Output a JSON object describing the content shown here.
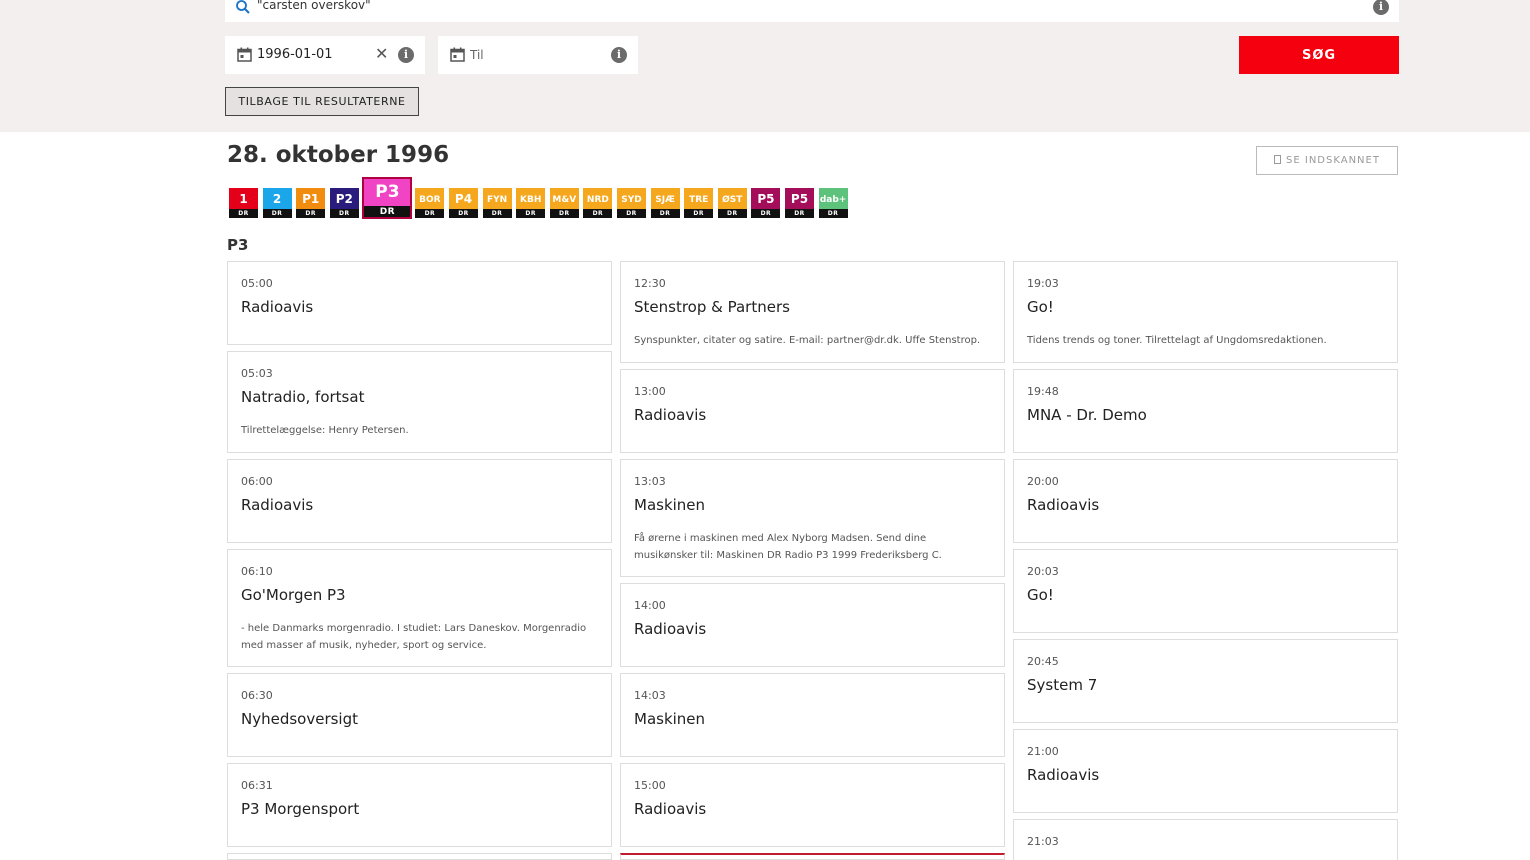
{
  "search": {
    "query": "\"carsten overskov\""
  },
  "filters": {
    "from_value": "1996-01-01",
    "to_placeholder": "Til",
    "search_button": "SØG"
  },
  "back_button": "TILBAGE TIL RESULTATERNE",
  "date_title": "28. oktober 1996",
  "scan_button": "SE INDSKANNET",
  "channels": [
    {
      "top": "1",
      "bottom": "DR",
      "color": "#e4001b"
    },
    {
      "top": "2",
      "bottom": "DR",
      "color": "#1aa6e8"
    },
    {
      "top": "P1",
      "bottom": "DR",
      "color": "#f28c0f"
    },
    {
      "top": "P2",
      "bottom": "DR",
      "color": "#2a1c7c"
    },
    {
      "top": "P3",
      "bottom": "DR",
      "color": "#f044c4"
    },
    {
      "top": "BOR",
      "bottom": "DR",
      "color": "#f5a81e"
    },
    {
      "top": "P4",
      "bottom": "DR",
      "color": "#f5a81e"
    },
    {
      "top": "FYN",
      "bottom": "DR",
      "color": "#f5a81e"
    },
    {
      "top": "KBH",
      "bottom": "DR",
      "color": "#f5a81e"
    },
    {
      "top": "M&V",
      "bottom": "DR",
      "color": "#f5a81e"
    },
    {
      "top": "NRD",
      "bottom": "DR",
      "color": "#f5a81e"
    },
    {
      "top": "SYD",
      "bottom": "DR",
      "color": "#f5a81e"
    },
    {
      "top": "SJÆ",
      "bottom": "DR",
      "color": "#f5a81e"
    },
    {
      "top": "TRE",
      "bottom": "DR",
      "color": "#f5a81e"
    },
    {
      "top": "ØST",
      "bottom": "DR",
      "color": "#f5a81e"
    },
    {
      "top": "P5",
      "bottom": "DR",
      "color": "#a30d5a"
    },
    {
      "top": "P5",
      "bottom": "DR",
      "color": "#a30d5a"
    },
    {
      "top": "dab+",
      "bottom": "DR",
      "color": "#5cc27c"
    }
  ],
  "channel_label": "P3",
  "columns": [
    [
      {
        "time": "05:00",
        "title": "Radioavis",
        "desc": ""
      },
      {
        "time": "05:03",
        "title": "Natradio, fortsat",
        "desc": "Tilrettelæggelse: Henry Petersen."
      },
      {
        "time": "06:00",
        "title": "Radioavis",
        "desc": ""
      },
      {
        "time": "06:10",
        "title": "Go'Morgen P3",
        "desc": "- hele Danmarks morgenradio. I studiet: Lars Daneskov. Morgenradio med masser af musik, nyheder, sport og service."
      },
      {
        "time": "06:30",
        "title": "Nyhedsoversigt",
        "desc": ""
      },
      {
        "time": "06:31",
        "title": "P3 Morgensport",
        "desc": ""
      }
    ],
    [
      {
        "time": "12:30",
        "title": "Stenstrop & Partners",
        "desc": "Synspunkter, citater og satire. E-mail: partner@dr.dk. Uffe Stenstrop."
      },
      {
        "time": "13:00",
        "title": "Radioavis",
        "desc": ""
      },
      {
        "time": "13:03",
        "title": "Maskinen",
        "desc": "Få ørerne i maskinen med Alex Nyborg Madsen. Send dine musikønsker til: Maskinen DR Radio P3 1999 Frederiksberg C."
      },
      {
        "time": "14:00",
        "title": "Radioavis",
        "desc": ""
      },
      {
        "time": "14:03",
        "title": "Maskinen",
        "desc": ""
      },
      {
        "time": "15:00",
        "title": "Radioavis",
        "desc": ""
      }
    ],
    [
      {
        "time": "19:03",
        "title": "Go!",
        "desc": "Tidens trends og toner. Tilrettelagt af Ungdomsredaktionen."
      },
      {
        "time": "19:48",
        "title": "MNA - Dr. Demo",
        "desc": ""
      },
      {
        "time": "20:00",
        "title": "Radioavis",
        "desc": ""
      },
      {
        "time": "20:03",
        "title": "Go!",
        "desc": ""
      },
      {
        "time": "20:45",
        "title": "System 7",
        "desc": ""
      },
      {
        "time": "21:00",
        "title": "Radioavis",
        "desc": ""
      },
      {
        "time": "21:03",
        "title": "",
        "desc": ""
      }
    ]
  ]
}
